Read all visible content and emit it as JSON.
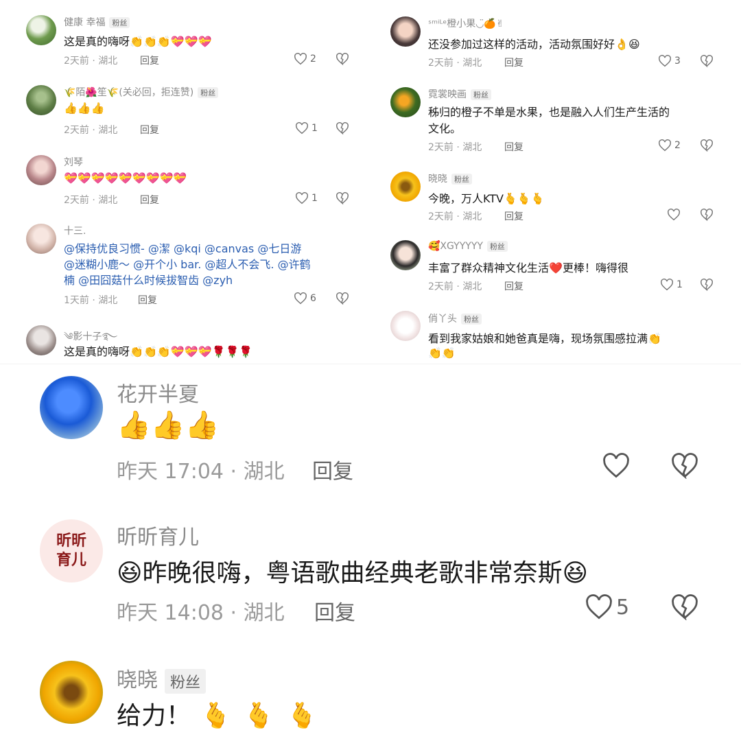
{
  "left_comments": [
    {
      "name": "健康 幸福",
      "badge": "粉丝",
      "text": "这是真的嗨呀",
      "emojis": "👏👏👏💝💝💝",
      "meta": "2天前 · 湖北",
      "reply": "回复",
      "likes": "2"
    },
    {
      "name": "🌾陌🌺笙🌾(关必回，拒连赞)",
      "badge": "粉丝",
      "text": "",
      "emojis": "👍👍👍",
      "meta": "2天前 · 湖北",
      "reply": "回复",
      "likes": "1"
    },
    {
      "name": "刘琴",
      "badge": "",
      "text": "",
      "emojis": "💝💝💝💝💝💝💝💝💝",
      "meta": "2天前 · 湖北",
      "reply": "回复",
      "likes": "1"
    },
    {
      "name": "十三.",
      "badge": "",
      "text_lines": [
        "@保持优良习惯- @潔 @kqi @canvas @七日游",
        "@迷糊小鹿～ @开个小 bar. @超人不会飞. @许鹤",
        "楠 @田囧菇什么时候拔智齿 @zyh"
      ],
      "meta": "1天前 · 湖北",
      "reply": "回复",
      "likes": "6"
    },
    {
      "name": "༄影十子࿐",
      "badge": "",
      "text": "这是真的嗨呀",
      "emojis": "👏👏👏💝💝💝🌹🌹🌹"
    }
  ],
  "right_comments": [
    {
      "name": "ˢᵐⁱᴸᵉ橙小果◡̈🍊✌",
      "badge": "",
      "text": "还没参加过这样的活动，活动氛围好好",
      "emojis": "👌😆",
      "meta": "2天前 · 湖北",
      "reply": "回复",
      "likes": "3"
    },
    {
      "name": "霓裳映画",
      "badge": "粉丝",
      "text_lines": [
        "秭归的橙子不单是水果，也是融入人们生产生活的",
        "文化。"
      ],
      "meta": "2天前 · 湖北",
      "reply": "回复",
      "likes": "2"
    },
    {
      "name": "晓晓",
      "badge": "粉丝",
      "text": "今晚，万人KTV",
      "emojis": "🫰🫰🫰",
      "meta": "2天前 · 湖北",
      "reply": "回复",
      "likes": ""
    },
    {
      "name": "🥰XGYYYYY",
      "badge": "粉丝",
      "text": "丰富了群众精神文化生活",
      "emojis": "❤️",
      "text2": "更棒！嗨得很",
      "meta": "2天前 · 湖北",
      "reply": "回复",
      "likes": "1"
    },
    {
      "name": "俏丫头",
      "badge": "粉丝",
      "text": "看到我家姑娘和她爸真是嗨，现场氛围感拉满",
      "emojis": "👏",
      "emojis2": "👏👏"
    }
  ],
  "large_comments": [
    {
      "name": "花开半夏",
      "badge": "",
      "text": "",
      "emojis": "👍👍👍",
      "meta": "昨天 17:04 · 湖北",
      "reply": "回复",
      "likes": ""
    },
    {
      "name": "昕昕育儿",
      "avatar_text": "昕昕育儿",
      "badge": "",
      "emojis_pre": "😆",
      "text": "昨晚很嗨，粤语歌曲经典老歌非常奈斯",
      "emojis": "😆",
      "meta": "昨天 14:08 · 湖北",
      "reply": "回复",
      "likes": "5"
    },
    {
      "name": "晓晓",
      "badge": "粉丝",
      "text": "给力！",
      "emojis": "🫰🫰🫰"
    }
  ]
}
